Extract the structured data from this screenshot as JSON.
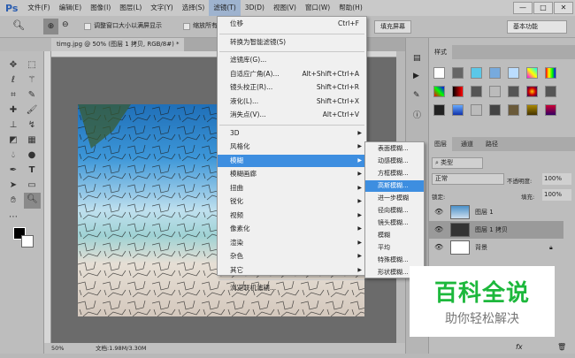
{
  "app": {
    "logo": "Ps"
  },
  "menubar": [
    "文件(F)",
    "编辑(E)",
    "图像(I)",
    "图层(L)",
    "文字(Y)",
    "选择(S)",
    "滤镜(T)",
    "3D(D)",
    "视图(V)",
    "窗口(W)",
    "帮助(H)"
  ],
  "window_controls": {
    "minimize": "—",
    "maximize": "□",
    "close": "✕"
  },
  "options": {
    "resize_windows": "调整窗口大小以满屏显示",
    "zoom_all": "缩放所有",
    "fill_screen": "填充屏幕",
    "workspace": "基本功能"
  },
  "document": {
    "tab": "timg.jpg @ 50% (图层 1 拷贝, RGB/8#) *",
    "close": "×",
    "zoom": "50%",
    "doc_size": "文档:1.98M/3.30M"
  },
  "filter_menu": {
    "top": [
      {
        "label": "位移",
        "shortcut": "Ctrl+F"
      }
    ],
    "smart": "转换为智能滤镜(S)",
    "group1": [
      {
        "label": "滤镜库(G)...",
        "shortcut": ""
      },
      {
        "label": "自适应广角(A)...",
        "shortcut": "Alt+Shift+Ctrl+A"
      },
      {
        "label": "镜头校正(R)...",
        "shortcut": "Shift+Ctrl+R"
      },
      {
        "label": "液化(L)...",
        "shortcut": "Shift+Ctrl+X"
      },
      {
        "label": "消失点(V)...",
        "shortcut": "Alt+Ctrl+V"
      }
    ],
    "submenus": [
      "3D",
      "风格化",
      "模糊",
      "模糊画廊",
      "扭曲",
      "锐化",
      "视频",
      "像素化",
      "渲染",
      "杂色",
      "其它"
    ],
    "browse": "浏览联机滤镜..."
  },
  "blur_submenu": [
    "表面模糊...",
    "动感模糊...",
    "方框模糊...",
    "高斯模糊...",
    "进一步模糊",
    "径向模糊...",
    "镜头模糊...",
    "模糊",
    "平均",
    "特殊模糊...",
    "形状模糊..."
  ],
  "styles_panel": {
    "title": "样式"
  },
  "layers_panel": {
    "tabs": [
      "图层",
      "通道",
      "路径"
    ],
    "filter_kind": "类型",
    "blend_mode": "正常",
    "opacity_label": "不透明度:",
    "opacity": "100%",
    "lock_label": "锁定:",
    "fill_label": "填充:",
    "fill": "100%",
    "layers": [
      {
        "name": "图层 1"
      },
      {
        "name": "图层 1 拷贝"
      },
      {
        "name": "背景"
      }
    ]
  },
  "watermark": {
    "title": "百科全说",
    "subtitle": "助你轻松解决"
  }
}
